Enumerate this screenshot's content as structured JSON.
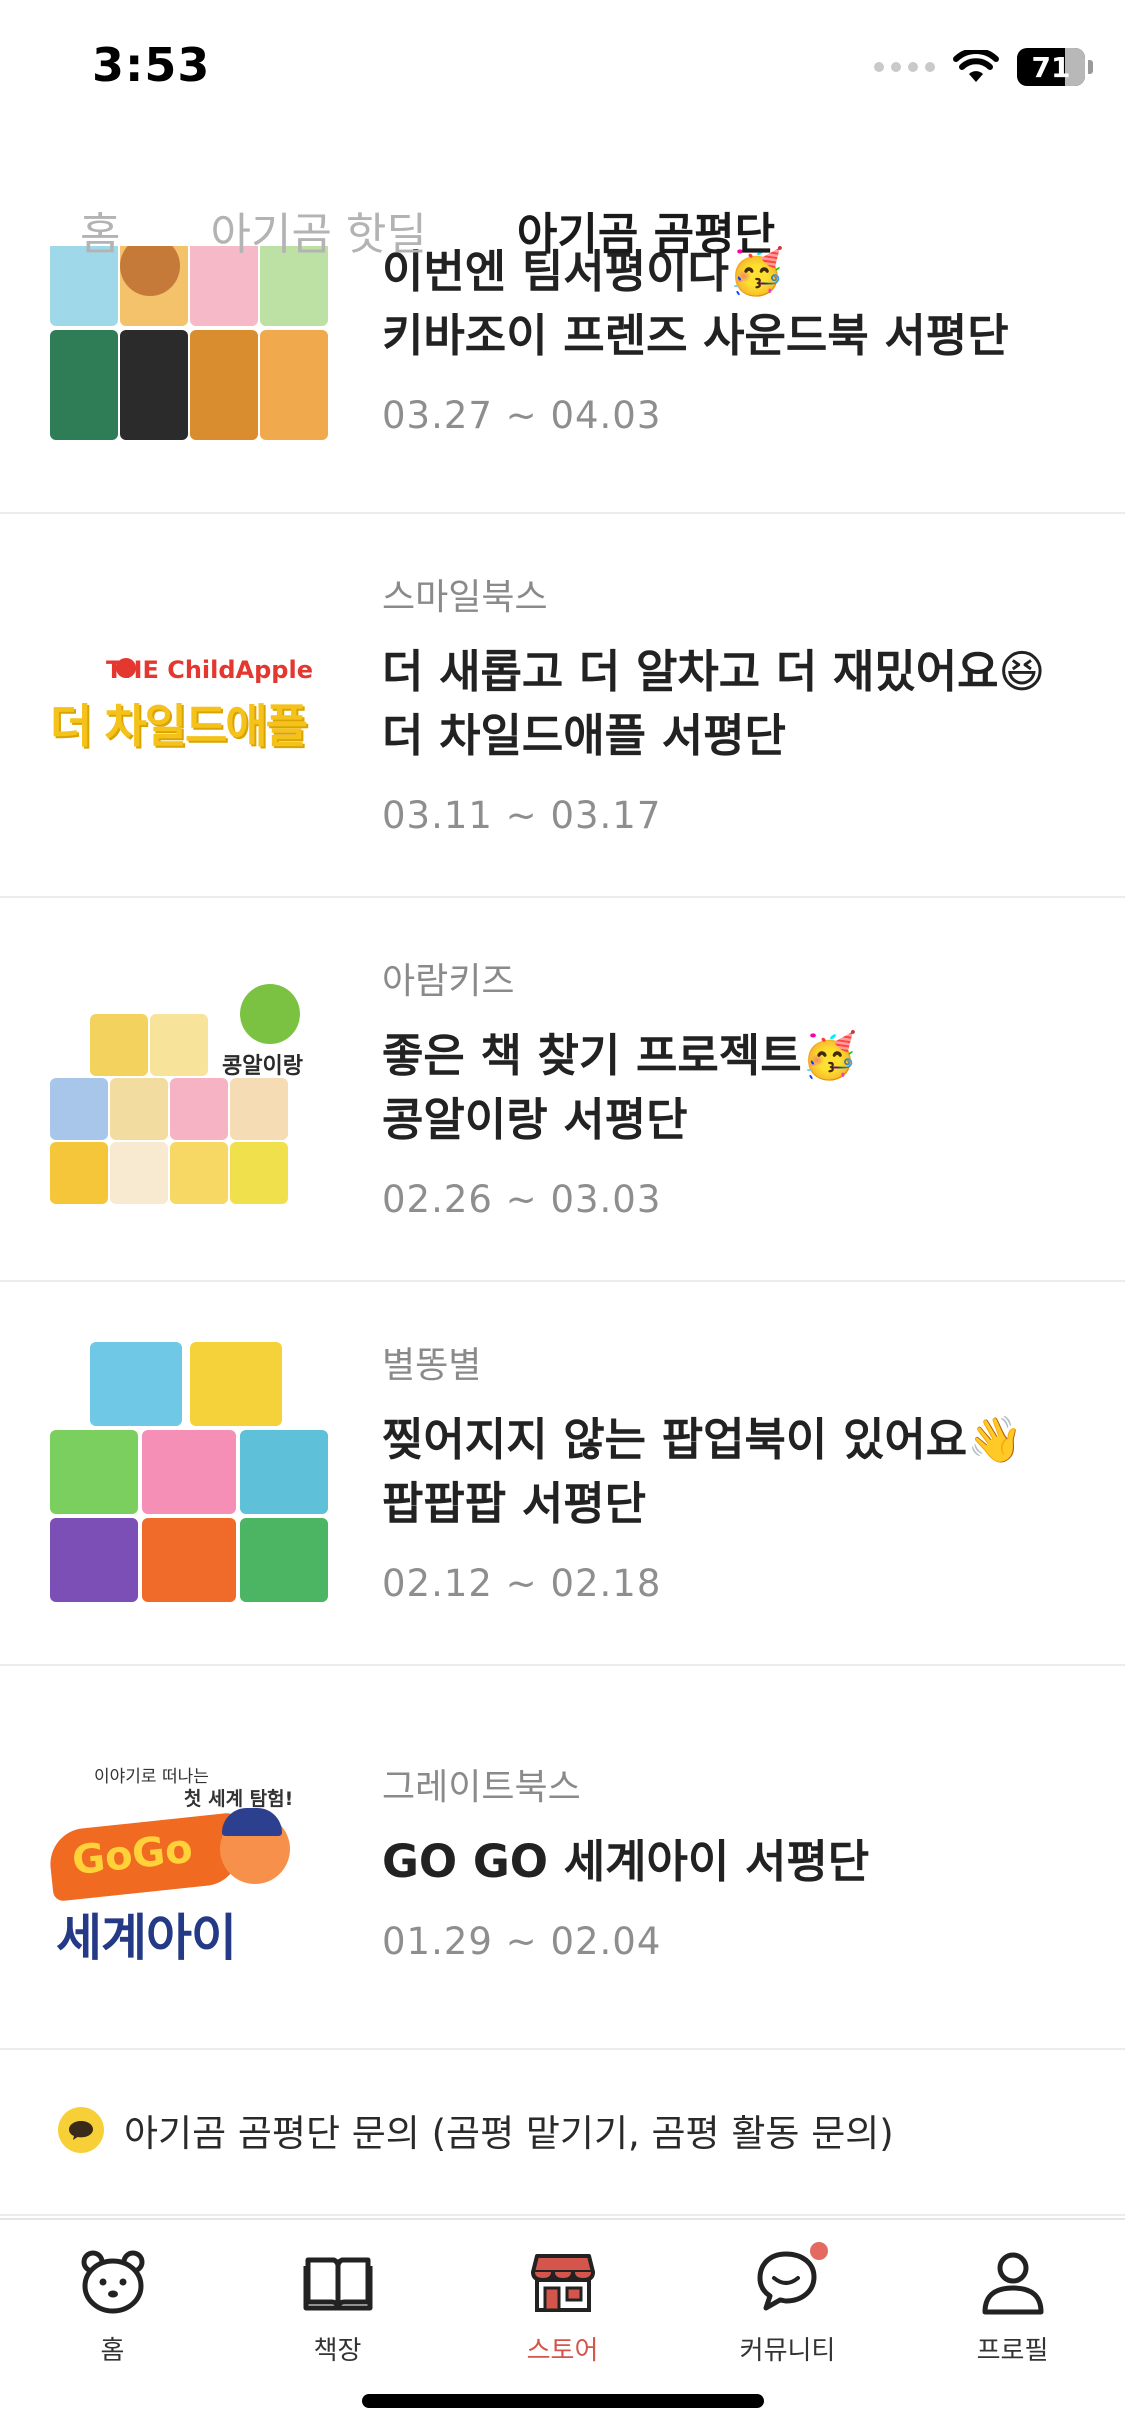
{
  "status": {
    "time": "3:53",
    "battery": "71",
    "battery_level": 0.71
  },
  "tabs": [
    {
      "label": "홈"
    },
    {
      "label": "아기곰 핫딜"
    },
    {
      "label": "아기곰 곰평단"
    }
  ],
  "items": [
    {
      "publisher": "",
      "title_line1": "이번엔 팀서평이다🥳",
      "title_line2": "키바조이 프렌즈 사운드북 서평단",
      "date": "03.27 ~ 04.03"
    },
    {
      "publisher": "스마일북스",
      "title_line1": "더 새롭고 더 알차고 더 재밌어요😆",
      "title_line2": "더 차일드애플 서평단",
      "date": "03.11 ~ 03.17",
      "logo_small": "THE ChildApple",
      "logo_big": "더 차일드애플"
    },
    {
      "publisher": "아람키즈",
      "title_line1": "좋은 책 찾기 프로젝트🥳",
      "title_line2": "콩알이랑 서평단",
      "date": "02.26 ~ 03.03",
      "logo_text": "콩알이랑"
    },
    {
      "publisher": "별똥별",
      "title_line1": "찢어지지 않는 팝업북이 있어요👋",
      "title_line2": "팝팝팝 서평단",
      "date": "02.12 ~ 02.18"
    },
    {
      "publisher": "그레이트북스",
      "title_line1": "GO GO 세계아이 서평단",
      "title_line2": "",
      "date": "01.29 ~ 02.04",
      "logo_top": "이야기로 떠나는",
      "logo_top2": "첫 세계 탐험!",
      "logo_gogo": "GoGo",
      "logo_main": "세계아이"
    }
  ],
  "inquiry": {
    "text": "아기곰 곰평단 문의 (곰평 맡기기, 곰평 활동 문의)"
  },
  "nav": [
    {
      "label": "홈",
      "icon": "bear-icon"
    },
    {
      "label": "책장",
      "icon": "book-icon"
    },
    {
      "label": "스토어",
      "icon": "store-icon"
    },
    {
      "label": "커뮤니티",
      "icon": "chat-icon"
    },
    {
      "label": "프로필",
      "icon": "profile-icon"
    }
  ],
  "colors": {
    "accent": "#d4554b",
    "badge": "#e46a61",
    "inquiry_icon": "#f7d038"
  }
}
